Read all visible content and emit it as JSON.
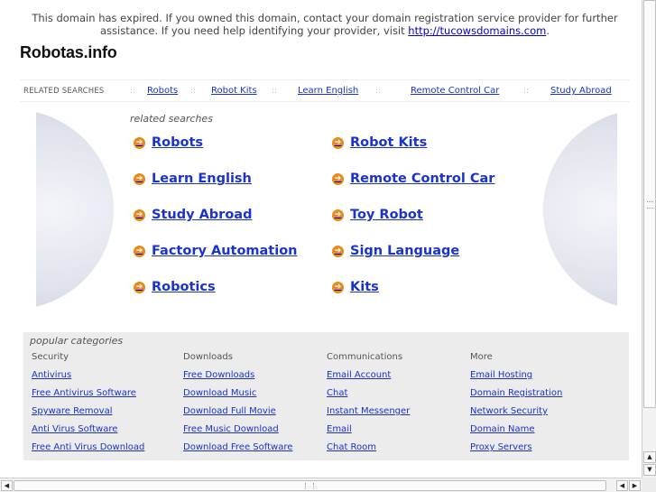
{
  "notice": {
    "text": "This domain has expired. If you owned this domain, contact your domain registration service provider for further assistance. If you need help identifying your provider, visit ",
    "link_text": "http://tucowsdomains.com",
    "trailing": "."
  },
  "site_title": "Robotas.info",
  "related_bar": {
    "label": "RELATED SEARCHES",
    "separator": "::",
    "links": [
      "Robots",
      "Robot Kits",
      "Learn English",
      "Remote Control Car",
      "Study Abroad"
    ]
  },
  "related_searches": {
    "heading": "related searches",
    "arrow_glyph": "➔",
    "left": [
      "Robots",
      "Learn English",
      "Study Abroad",
      "Factory Automation",
      "Robotics"
    ],
    "right": [
      "Robot Kits",
      "Remote Control Car",
      "Toy Robot",
      "Sign Language",
      "Kits"
    ]
  },
  "popular": {
    "heading": "popular categories",
    "columns": [
      {
        "title": "Security",
        "links": [
          "Antivirus",
          "Free Antivirus Software",
          "Spyware Removal",
          "Anti Virus Software",
          "Free Anti Virus Download"
        ]
      },
      {
        "title": "Downloads",
        "links": [
          "Free Downloads",
          "Download Music",
          "Download Full Movie",
          "Free Music Download",
          "Download Free Software"
        ]
      },
      {
        "title": "Communications",
        "links": [
          "Email Account",
          "Chat",
          "Instant Messenger",
          "Email",
          "Chat Room"
        ]
      },
      {
        "title": "More",
        "links": [
          "Email Hosting",
          "Domain Registration",
          "Network Security",
          "Domain Name",
          "Proxy Servers"
        ]
      }
    ]
  },
  "scrollbar_glyphs": {
    "up": "▲",
    "down": "▼",
    "left": "◀",
    "right": "▶"
  },
  "colors": {
    "link": "#1a33cc",
    "arrow": "#e58a1c",
    "panel": "#ececec"
  }
}
